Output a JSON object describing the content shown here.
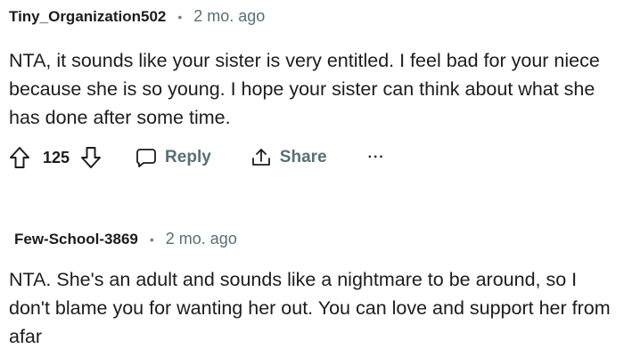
{
  "comments": [
    {
      "author": "Tiny_Organization502",
      "separator": "•",
      "time": "2 mo. ago",
      "body": "NTA, it sounds like your sister is very entitled. I feel bad for your niece because she is so young. I hope your sister can think about what she has done after some time.",
      "score": "125",
      "reply_label": "Reply",
      "share_label": "Share",
      "more_label": "···",
      "icons": [
        "upvote-icon",
        "downvote-icon",
        "reply-icon",
        "share-icon",
        "more-icon"
      ]
    },
    {
      "author": "Few-School-3869",
      "separator": "•",
      "time": "2 mo. ago",
      "body": "NTA. She's an adult and sounds like a nightmare to be around, so I don't blame you for wanting her out. You can love and support her from afar"
    }
  ]
}
